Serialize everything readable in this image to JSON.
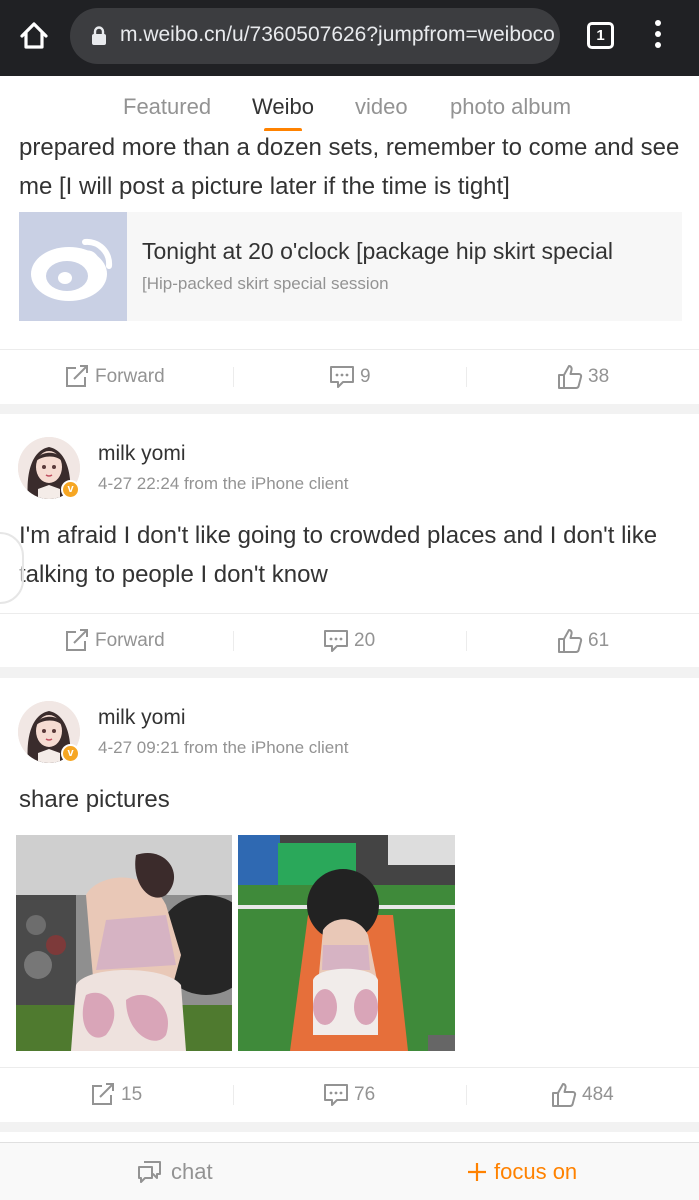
{
  "browser": {
    "url": "m.weibo.cn/u/7360507626?jumpfrom=weibocom",
    "tab_count": "1"
  },
  "tabs": [
    {
      "label": "Featured"
    },
    {
      "label": "Weibo"
    },
    {
      "label": "video"
    },
    {
      "label": "photo album"
    }
  ],
  "post1": {
    "text": "prepared more than a dozen sets, remember to come and see me [I will post a picture later if the time is tight]",
    "article_title": "Tonight at 20 o'clock [package hip skirt special",
    "article_sub": "[Hip-packed skirt special session",
    "forward": "Forward",
    "comments": "9",
    "likes": "38"
  },
  "post2": {
    "user": "milk yomi",
    "meta": "4-27 22:24 from the iPhone client",
    "text": "I'm afraid I don't like going to crowded places and I don't like talking to people I don't know",
    "forward": "Forward",
    "comments": "20",
    "likes": "61"
  },
  "post3": {
    "user": "milk yomi",
    "meta": "4-27 09:21 from the iPhone client",
    "text": "share pictures",
    "forward": "15",
    "comments": "76",
    "likes": "484"
  },
  "bottom": {
    "chat": "chat",
    "focus": "focus on"
  },
  "colors": {
    "accent": "#ff8200",
    "muted": "#939393",
    "verified": "#f6a623"
  },
  "icons": [
    "home-icon",
    "lock-icon",
    "tabs-icon",
    "more-icon",
    "forward-icon",
    "comment-icon",
    "like-icon",
    "chat-icon",
    "plus-icon",
    "verified-icon"
  ]
}
